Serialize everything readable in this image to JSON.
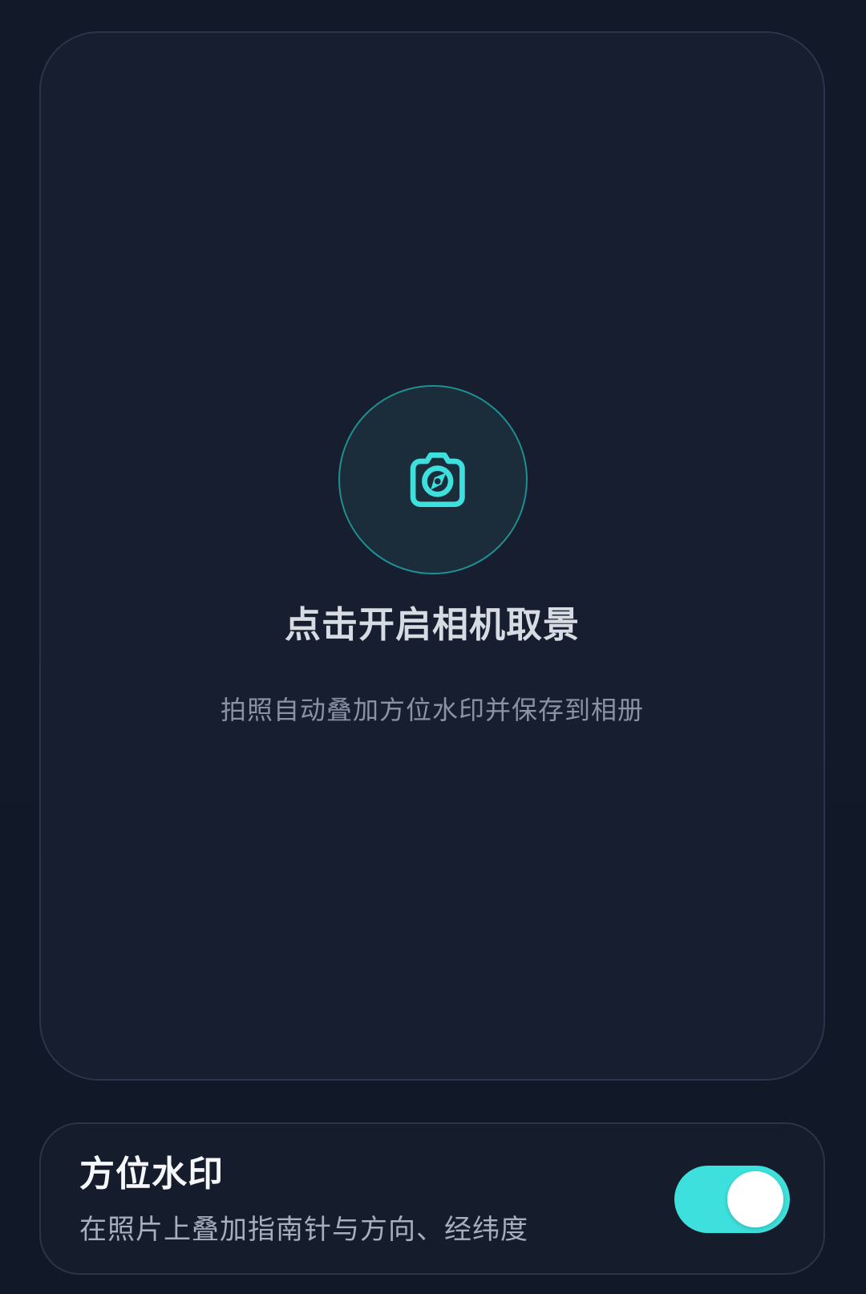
{
  "camera": {
    "icon": "camera-compass-icon",
    "title": "点击开启相机取景",
    "subtitle": "拍照自动叠加方位水印并保存到相册"
  },
  "watermark": {
    "title": "方位水印",
    "description": "在照片上叠加指南针与方向、经纬度",
    "toggle_on": true
  },
  "colors": {
    "accent": "#3ee0dd",
    "card_background": "#161e2f",
    "page_background": "#111827"
  }
}
